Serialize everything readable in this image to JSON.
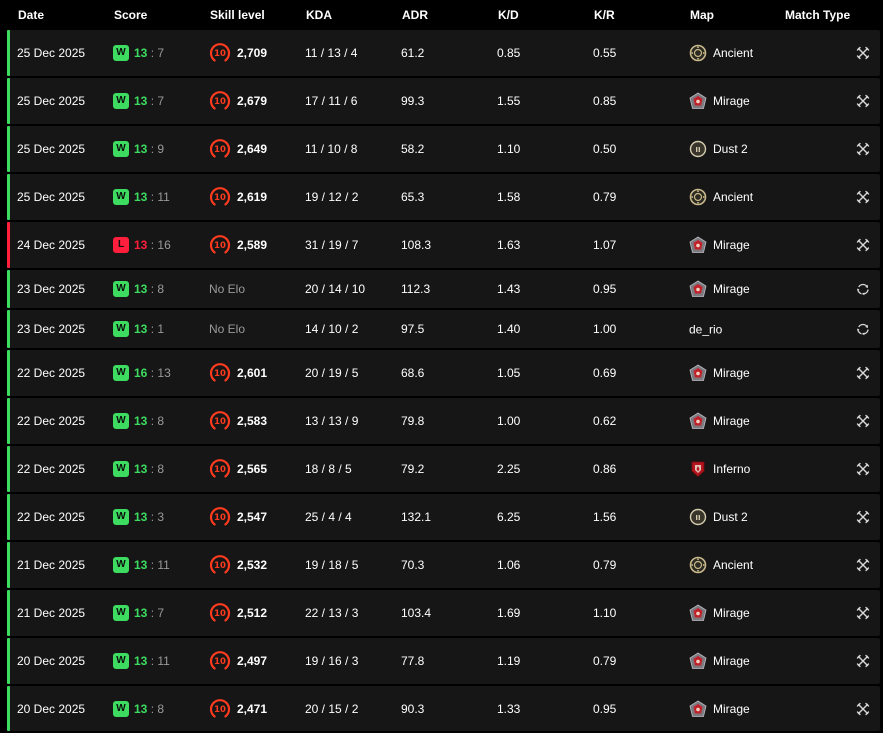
{
  "columns": {
    "date": "Date",
    "score": "Score",
    "skill": "Skill level",
    "kda": "KDA",
    "adr": "ADR",
    "kd": "K/D",
    "kr": "K/R",
    "map": "Map",
    "match_type": "Match Type"
  },
  "colors": {
    "win": "#3ddc60",
    "loss": "#ff1e3c",
    "skill_ring": "#ff3b1f",
    "row_bg": "#161616",
    "muted": "#9a9a9a"
  },
  "matches": [
    {
      "date": "25 Dec 2025",
      "result": "W",
      "score_mine": "13",
      "score_sep": ":",
      "score_theirs": "7",
      "level": "10",
      "elo": "2,709",
      "kda": "11 / 13 / 4",
      "adr": "61.2",
      "kd": "0.85",
      "kr": "0.55",
      "map": "Ancient",
      "map_icon": "ancient-map-icon",
      "match_type_icon": "crossed-swords-icon"
    },
    {
      "date": "25 Dec 2025",
      "result": "W",
      "score_mine": "13",
      "score_sep": ":",
      "score_theirs": "7",
      "level": "10",
      "elo": "2,679",
      "kda": "17 / 11 / 6",
      "adr": "99.3",
      "kd": "1.55",
      "kr": "0.85",
      "map": "Mirage",
      "map_icon": "mirage-map-icon",
      "match_type_icon": "crossed-swords-icon"
    },
    {
      "date": "25 Dec 2025",
      "result": "W",
      "score_mine": "13",
      "score_sep": ":",
      "score_theirs": "9",
      "level": "10",
      "elo": "2,649",
      "kda": "11 / 10 / 8",
      "adr": "58.2",
      "kd": "1.10",
      "kr": "0.50",
      "map": "Dust 2",
      "map_icon": "dust2-map-icon",
      "match_type_icon": "crossed-swords-icon"
    },
    {
      "date": "25 Dec 2025",
      "result": "W",
      "score_mine": "13",
      "score_sep": ":",
      "score_theirs": "11",
      "level": "10",
      "elo": "2,619",
      "kda": "19 / 12 / 2",
      "adr": "65.3",
      "kd": "1.58",
      "kr": "0.79",
      "map": "Ancient",
      "map_icon": "ancient-map-icon",
      "match_type_icon": "crossed-swords-icon"
    },
    {
      "date": "24 Dec 2025",
      "result": "L",
      "score_mine": "13",
      "score_sep": ":",
      "score_theirs": "16",
      "level": "10",
      "elo": "2,589",
      "kda": "31 / 19 / 7",
      "adr": "108.3",
      "kd": "1.63",
      "kr": "1.07",
      "map": "Mirage",
      "map_icon": "mirage-map-icon",
      "match_type_icon": "crossed-swords-icon"
    },
    {
      "date": "23 Dec 2025",
      "result": "W",
      "score_mine": "13",
      "score_sep": ":",
      "score_theirs": "8",
      "level": "",
      "elo": "No Elo",
      "kda": "20 / 14 / 10",
      "adr": "112.3",
      "kd": "1.43",
      "kr": "0.95",
      "map": "Mirage",
      "map_icon": "mirage-map-icon",
      "match_type_icon": "circle-arrows-icon"
    },
    {
      "date": "23 Dec 2025",
      "result": "W",
      "score_mine": "13",
      "score_sep": ":",
      "score_theirs": "1",
      "level": "",
      "elo": "No Elo",
      "kda": "14 / 10 / 2",
      "adr": "97.5",
      "kd": "1.40",
      "kr": "1.00",
      "map": "de_rio",
      "map_icon": "",
      "match_type_icon": "circle-arrows-icon"
    },
    {
      "date": "22 Dec 2025",
      "result": "W",
      "score_mine": "16",
      "score_sep": ":",
      "score_theirs": "13",
      "level": "10",
      "elo": "2,601",
      "kda": "20 / 19 / 5",
      "adr": "68.6",
      "kd": "1.05",
      "kr": "0.69",
      "map": "Mirage",
      "map_icon": "mirage-map-icon",
      "match_type_icon": "crossed-swords-icon"
    },
    {
      "date": "22 Dec 2025",
      "result": "W",
      "score_mine": "13",
      "score_sep": ":",
      "score_theirs": "8",
      "level": "10",
      "elo": "2,583",
      "kda": "13 / 13 / 9",
      "adr": "79.8",
      "kd": "1.00",
      "kr": "0.62",
      "map": "Mirage",
      "map_icon": "mirage-map-icon",
      "match_type_icon": "crossed-swords-icon"
    },
    {
      "date": "22 Dec 2025",
      "result": "W",
      "score_mine": "13",
      "score_sep": ":",
      "score_theirs": "8",
      "level": "10",
      "elo": "2,565",
      "kda": "18 / 8 / 5",
      "adr": "79.2",
      "kd": "2.25",
      "kr": "0.86",
      "map": "Inferno",
      "map_icon": "inferno-map-icon",
      "match_type_icon": "crossed-swords-icon"
    },
    {
      "date": "22 Dec 2025",
      "result": "W",
      "score_mine": "13",
      "score_sep": ":",
      "score_theirs": "3",
      "level": "10",
      "elo": "2,547",
      "kda": "25 / 4 / 4",
      "adr": "132.1",
      "kd": "6.25",
      "kr": "1.56",
      "map": "Dust 2",
      "map_icon": "dust2-map-icon",
      "match_type_icon": "crossed-swords-icon"
    },
    {
      "date": "21 Dec 2025",
      "result": "W",
      "score_mine": "13",
      "score_sep": ":",
      "score_theirs": "11",
      "level": "10",
      "elo": "2,532",
      "kda": "19 / 18 / 5",
      "adr": "70.3",
      "kd": "1.06",
      "kr": "0.79",
      "map": "Ancient",
      "map_icon": "ancient-map-icon",
      "match_type_icon": "crossed-swords-icon"
    },
    {
      "date": "21 Dec 2025",
      "result": "W",
      "score_mine": "13",
      "score_sep": ":",
      "score_theirs": "7",
      "level": "10",
      "elo": "2,512",
      "kda": "22 / 13 / 3",
      "adr": "103.4",
      "kd": "1.69",
      "kr": "1.10",
      "map": "Mirage",
      "map_icon": "mirage-map-icon",
      "match_type_icon": "crossed-swords-icon"
    },
    {
      "date": "20 Dec 2025",
      "result": "W",
      "score_mine": "13",
      "score_sep": ":",
      "score_theirs": "11",
      "level": "10",
      "elo": "2,497",
      "kda": "19 / 16 / 3",
      "adr": "77.8",
      "kd": "1.19",
      "kr": "0.79",
      "map": "Mirage",
      "map_icon": "mirage-map-icon",
      "match_type_icon": "crossed-swords-icon"
    },
    {
      "date": "20 Dec 2025",
      "result": "W",
      "score_mine": "13",
      "score_sep": ":",
      "score_theirs": "8",
      "level": "10",
      "elo": "2,471",
      "kda": "20 / 15 / 2",
      "adr": "90.3",
      "kd": "1.33",
      "kr": "0.95",
      "map": "Mirage",
      "map_icon": "mirage-map-icon",
      "match_type_icon": "crossed-swords-icon"
    }
  ]
}
